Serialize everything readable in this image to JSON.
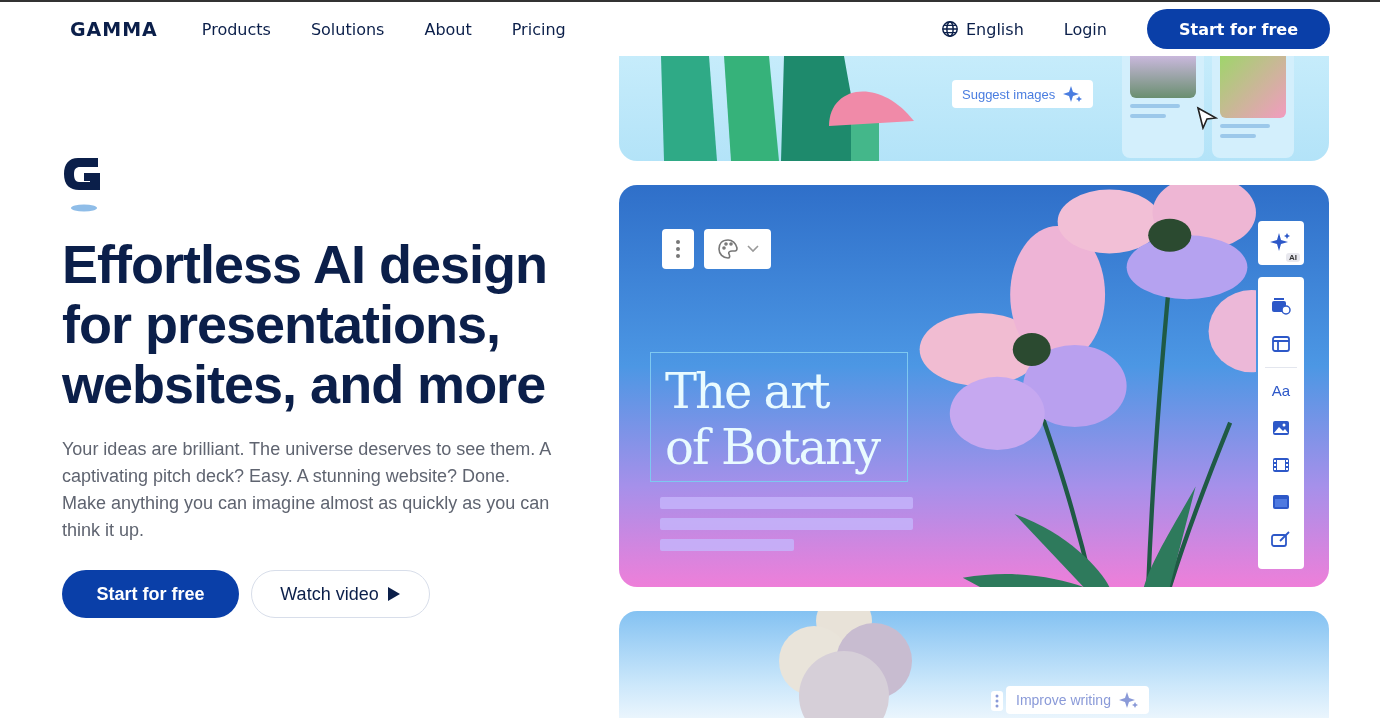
{
  "header": {
    "logo": "GAMMA",
    "nav": [
      "Products",
      "Solutions",
      "About",
      "Pricing"
    ],
    "language": "English",
    "login": "Login",
    "cta": "Start for free"
  },
  "hero": {
    "heading": "Effortless AI design for presentations, websites, and more",
    "body": "Your ideas are brilliant. The universe deserves to see them. A captivating pitch deck? Easy. A stunning website? Done. Make anything you can imagine almost as quickly as you can think it up.",
    "primary": "Start for free",
    "secondary": "Watch video"
  },
  "showcase": {
    "top_card": {
      "chip": "Suggest images"
    },
    "main_card": {
      "title_lines": [
        "The art",
        "of Botany"
      ],
      "ai_badge": "AI",
      "text_tool": "Aa"
    },
    "bottom_card": {
      "chip": "Improve writing"
    }
  }
}
